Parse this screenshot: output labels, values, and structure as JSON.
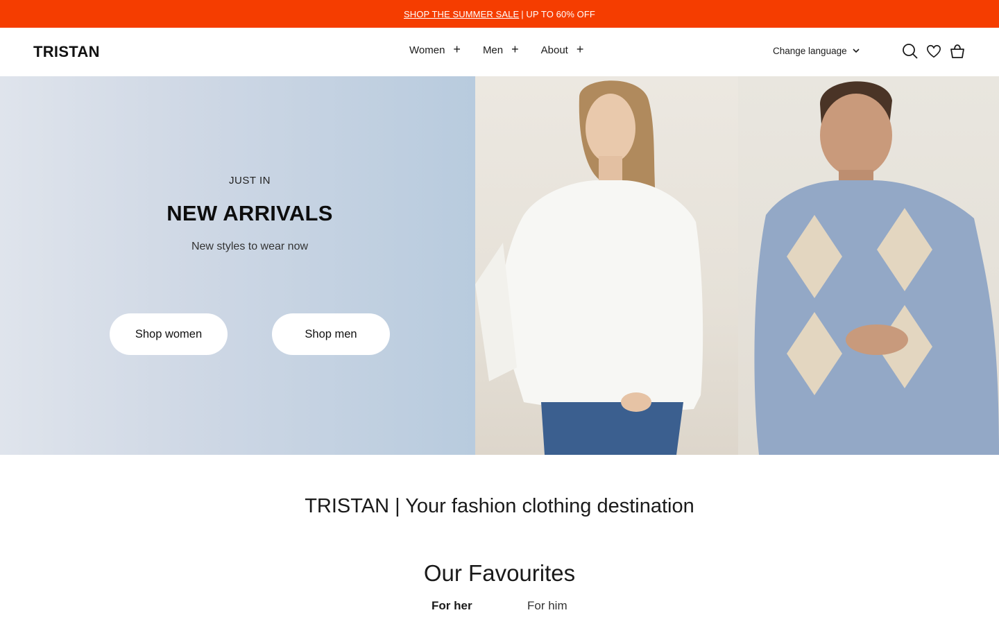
{
  "announcement": {
    "link": "SHOP THE SUMMER SALE",
    "rest": "| UP TO 60% OFF"
  },
  "header": {
    "logo": "TRISTAN",
    "nav": [
      {
        "label": "Women"
      },
      {
        "label": "Men"
      },
      {
        "label": "About"
      }
    ],
    "nav_expand_glyph": "+",
    "language": "Change language",
    "icons": [
      "search-icon",
      "heart-icon",
      "basket-icon"
    ]
  },
  "hero": {
    "eyebrow": "JUST IN",
    "title": "NEW ARRIVALS",
    "subtitle": "New styles to wear now",
    "buttons": {
      "women": "Shop women",
      "men": "Shop men"
    }
  },
  "tagline": "TRISTAN | Your fashion clothing destination",
  "favourites": {
    "title": "Our Favourites",
    "tabs": [
      {
        "label": "For her",
        "active": true
      },
      {
        "label": "For him",
        "active": false
      }
    ]
  },
  "colors": {
    "accent": "#f53d00",
    "hero_bg": "#c9d5e3"
  }
}
